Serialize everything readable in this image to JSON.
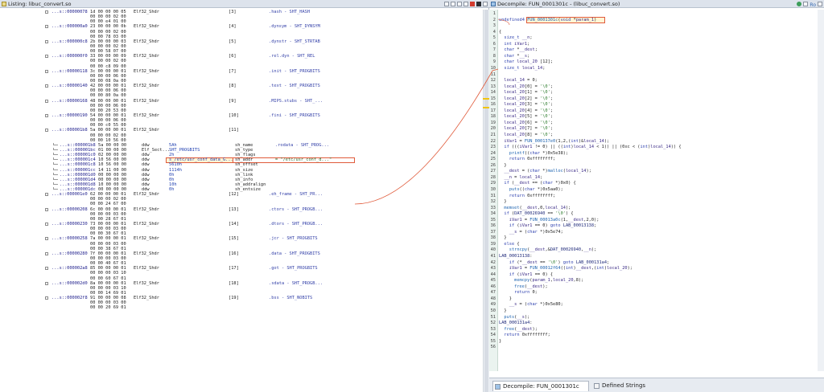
{
  "listing": {
    "title": "Listing:  libuc_convert.so",
    "icons": [
      "snapshot-icon",
      "copy-icon",
      "paste-icon",
      "home-icon",
      "flag-icon",
      "settings-icon",
      "close-icon"
    ]
  },
  "decompile": {
    "title": "Decompile: FUN_0001301c - (libuc_convert.so)",
    "icon_ro": "Ro"
  },
  "listing_rows": [
    {
      "addr": "...s::00000078",
      "bytes": "1d 00 00 00 05",
      "mnem": "Elf32_Shdr",
      "op": "[3]",
      "sect": ".hash - SHT_HASH"
    },
    {
      "bytes": "00 00 00 02 00"
    },
    {
      "bytes": "00 00 e4 01 00"
    },
    {
      "addr": "...s::000000a0",
      "bytes": "23 00 00 00 0b",
      "mnem": "Elf32_Shdr",
      "op": "[4]",
      "sect": ".dynsym - SHT_DYNSYM"
    },
    {
      "bytes": "00 00 00 02 00"
    },
    {
      "bytes": "00 00 78 03 00"
    },
    {
      "addr": "...s::000000c8",
      "bytes": "2b 00 00 00 03",
      "mnem": "Elf32_Shdr",
      "op": "[5]",
      "sect": ".dynstr - SHT_STRTAB"
    },
    {
      "bytes": "00 00 00 02 00"
    },
    {
      "bytes": "00 00 58 07 00"
    },
    {
      "addr": "...s::000000f0",
      "bytes": "33 00 00 00 09",
      "mnem": "Elf32_Shdr",
      "op": "[6]",
      "sect": ".rel.dyn - SHT_REL"
    },
    {
      "bytes": "00 00 00 02 00"
    },
    {
      "bytes": "00 00 c8 09 00"
    },
    {
      "addr": "...s::00000118",
      "bytes": "3c 00 00 00 01",
      "mnem": "Elf32_Shdr",
      "op": "[7]",
      "sect": ".init - SHT_PROGBITS"
    },
    {
      "bytes": "00 00 00 06 00"
    },
    {
      "bytes": "00 00 08 0a 00"
    },
    {
      "addr": "...s::00000140",
      "bytes": "42 00 00 00 01",
      "mnem": "Elf32_Shdr",
      "op": "[8]",
      "sect": ".text - SHT_PROGBITS"
    },
    {
      "bytes": "00 00 00 06 00"
    },
    {
      "bytes": "00 00 80 0a 00"
    },
    {
      "addr": "...s::00000168",
      "bytes": "48 00 00 00 01",
      "mnem": "Elf32_Shdr",
      "op": "[9]",
      "sect": ".MIPS.stubs - SHT_..."
    },
    {
      "bytes": "00 00 00 06 00"
    },
    {
      "bytes": "00 00 20 53 00"
    },
    {
      "addr": "...s::00000190",
      "bytes": "54 00 00 00 01",
      "mnem": "Elf32_Shdr",
      "op": "[10]",
      "sect": ".fini - SHT_PROGBITS"
    },
    {
      "bytes": "00 00 00 06 00"
    },
    {
      "bytes": "00 00 c0 55 00"
    },
    {
      "addr": "...s::000001b8",
      "bytes": "5a 00 00 00 01",
      "mnem": "Elf32_Shdr",
      "op": "[11]",
      "sect": ""
    },
    {
      "bytes": "00 00 00 02 00"
    },
    {
      "bytes": "00 00 10 56 00"
    },
    {
      "addr": "...s::000001b8",
      "bytes": "5a 00 00 00",
      "mnem": "ddw",
      "op": "5Ah",
      "field": "sh_name",
      "sect": ".rodata - SHT_PROG..."
    },
    {
      "addr": "...s::000001bc",
      "bytes": "01 00 00 00",
      "mnem": "Elf_Sect...",
      "op": "SHT_PROGBITS",
      "field": "sh_type"
    },
    {
      "addr": "...s::000001c0",
      "bytes": "02 00 00 00",
      "mnem": "ddw",
      "op": "2h",
      "field": "sh_flags"
    },
    {
      "addr": "...s::000001c4",
      "bytes": "10 56 00 00",
      "mnem": "ddw",
      "op": "s_/etc/usr_conf_data_G...",
      "field": "sh_addr",
      "sect": "= \"/etc/usr_conf_d...\""
    },
    {
      "addr": "...s::000001c8",
      "bytes": "10 56 00 00",
      "mnem": "ddw",
      "op": "5610h",
      "field": "sh_offset"
    },
    {
      "addr": "...s::000001cc",
      "bytes": "14 11 00 00",
      "mnem": "ddw",
      "op": "1114h",
      "field": "sh_size"
    },
    {
      "addr": "...s::000001d0",
      "bytes": "00 00 00 00",
      "mnem": "ddw",
      "op": "0h",
      "field": "sh_link"
    },
    {
      "addr": "...s::000001d4",
      "bytes": "00 00 00 00",
      "mnem": "ddw",
      "op": "0h",
      "field": "sh_info"
    },
    {
      "addr": "...s::000001d8",
      "bytes": "10 00 00 00",
      "mnem": "ddw",
      "op": "10h",
      "field": "sh_addralign"
    },
    {
      "addr": "...s::000001dc",
      "bytes": "00 00 00 00",
      "mnem": "ddw",
      "op": "0h",
      "field": "sh_entsize"
    },
    {
      "addr": "...s::000001e0",
      "bytes": "62 00 00 00 01",
      "mnem": "Elf32_Shdr",
      "op": "[12]",
      "sect": ".eh_frame - SHT_PR..."
    },
    {
      "bytes": "00 00 00 02 00"
    },
    {
      "bytes": "00 00 24 67 00"
    },
    {
      "addr": "...s::00000208",
      "bytes": "6c 00 00 00 01",
      "mnem": "Elf32_Shdr",
      "op": "[13]",
      "sect": ".ctors - SHT_PROGB..."
    },
    {
      "bytes": "00 00 00 03 00"
    },
    {
      "bytes": "00 00 28 67 01"
    },
    {
      "addr": "...s::00000230",
      "bytes": "73 00 00 00 01",
      "mnem": "Elf32_Shdr",
      "op": "[14]",
      "sect": ".dtors - SHT_PROGB..."
    },
    {
      "bytes": "00 00 00 03 00"
    },
    {
      "bytes": "00 00 30 67 01"
    },
    {
      "addr": "...s::00000258",
      "bytes": "7a 00 00 00 01",
      "mnem": "Elf32_Shdr",
      "op": "[15]",
      "sect": ".jcr - SHT_PROGBITS"
    },
    {
      "bytes": "00 00 00 03 00"
    },
    {
      "bytes": "00 00 38 67 01"
    },
    {
      "addr": "...s::00000280",
      "bytes": "7f 00 00 00 01",
      "mnem": "Elf32_Shdr",
      "op": "[16]",
      "sect": ".data - SHT_PROGBITS"
    },
    {
      "bytes": "00 00 00 03 00"
    },
    {
      "bytes": "00 00 40 67 01"
    },
    {
      "addr": "...s::000002a8",
      "bytes": "85 00 00 00 01",
      "mnem": "Elf32_Shdr",
      "op": "[17]",
      "sect": ".got - SHT_PROGBITS"
    },
    {
      "bytes": "00 00 00 03 10"
    },
    {
      "bytes": "00 00 60 67 01"
    },
    {
      "addr": "...s::000002d0",
      "bytes": "8a 00 00 00 01",
      "mnem": "Elf32_Shdr",
      "op": "[18]",
      "sect": ".sdata - SHT_PROGB..."
    },
    {
      "bytes": "00 00 00 03 10"
    },
    {
      "bytes": "00 00 14 69 01"
    },
    {
      "addr": "...s::000002f8",
      "bytes": "91 00 00 00 08",
      "mnem": "Elf32_Shdr",
      "op": "[19]",
      "sect": ".bss - SHT_NOBITS"
    },
    {
      "bytes": "00 00 00 03 00"
    },
    {
      "bytes": "00 00 20 69 01"
    }
  ],
  "code_lines": [
    "",
    "undefined4 FUN_0001301c(void *param_1)",
    "",
    "{",
    "  size_t __n;",
    "  int iVar1;",
    "  char *__dest;",
    "  char *__s;",
    "  char local_20 [12];",
    "  size_t local_14;",
    "",
    "  local_14 = 0;",
    "  local_20[0] = '\\0';",
    "  local_20[1] = '\\0';",
    "  local_20[2] = '\\0';",
    "  local_20[3] = '\\0';",
    "  local_20[4] = '\\0';",
    "  local_20[5] = '\\0';",
    "  local_20[6] = '\\0';",
    "  local_20[7] = '\\0';",
    "  local_20[8] = '\\0';",
    "  iVar1 = FUN_000137e0(1,2,(int)&local_14);",
    "  if (((iVar1 != 0) || ((int)local_14 < 1)) || (0xc < (int)local_14)) {",
    "    printf((char *)0x5e38);",
    "    return 0xffffffff;",
    "  }",
    "  __dest = (char *)malloc(local_14);",
    "  __n = local_14;",
    "  if (__dest == (char *)0x0) {",
    "    puts((char *)0x5aa0);",
    "    return 0xffffffff;",
    "  }",
    "  memset(__dest,0,local_14);",
    "  if (DAT_00026940 == '\\0') {",
    "    iVar1 = FUN_00013a0c(1,__dest,2,0);",
    "    if (iVar1 == 0) goto LAB_00013138;",
    "    __s = (char *)0x5e74;",
    "  }",
    "  else {",
    "    strncpy(__dest,&DAT_00026940,__n);",
    "LAB_00013138:",
    "    if (*__dest == '\\0') goto LAB_000131a4;",
    "    iVar1 = FUN_00012f64((int)__dest,(int)local_20);",
    "    if (iVar1 == 0) {",
    "      memcpy(param_1,local_20,8);",
    "      free(__dest);",
    "      return 0;",
    "    }",
    "    __s = (char *)0x5e80;",
    "  }",
    "  puts(__s);",
    "LAB_000131a4:",
    "  free(__dest);",
    "  return 0xffffffff;",
    "}",
    ""
  ],
  "tabs": [
    {
      "label": "Decompile: FUN_0001301c",
      "icon": "decompile-icon"
    },
    {
      "label": "Defined Strings",
      "icon": "strings-icon"
    }
  ],
  "colors": {
    "highlight_border": "#e05a3a",
    "highlight_fill": "#fff6d5",
    "title_bg": "#dde3ec"
  }
}
